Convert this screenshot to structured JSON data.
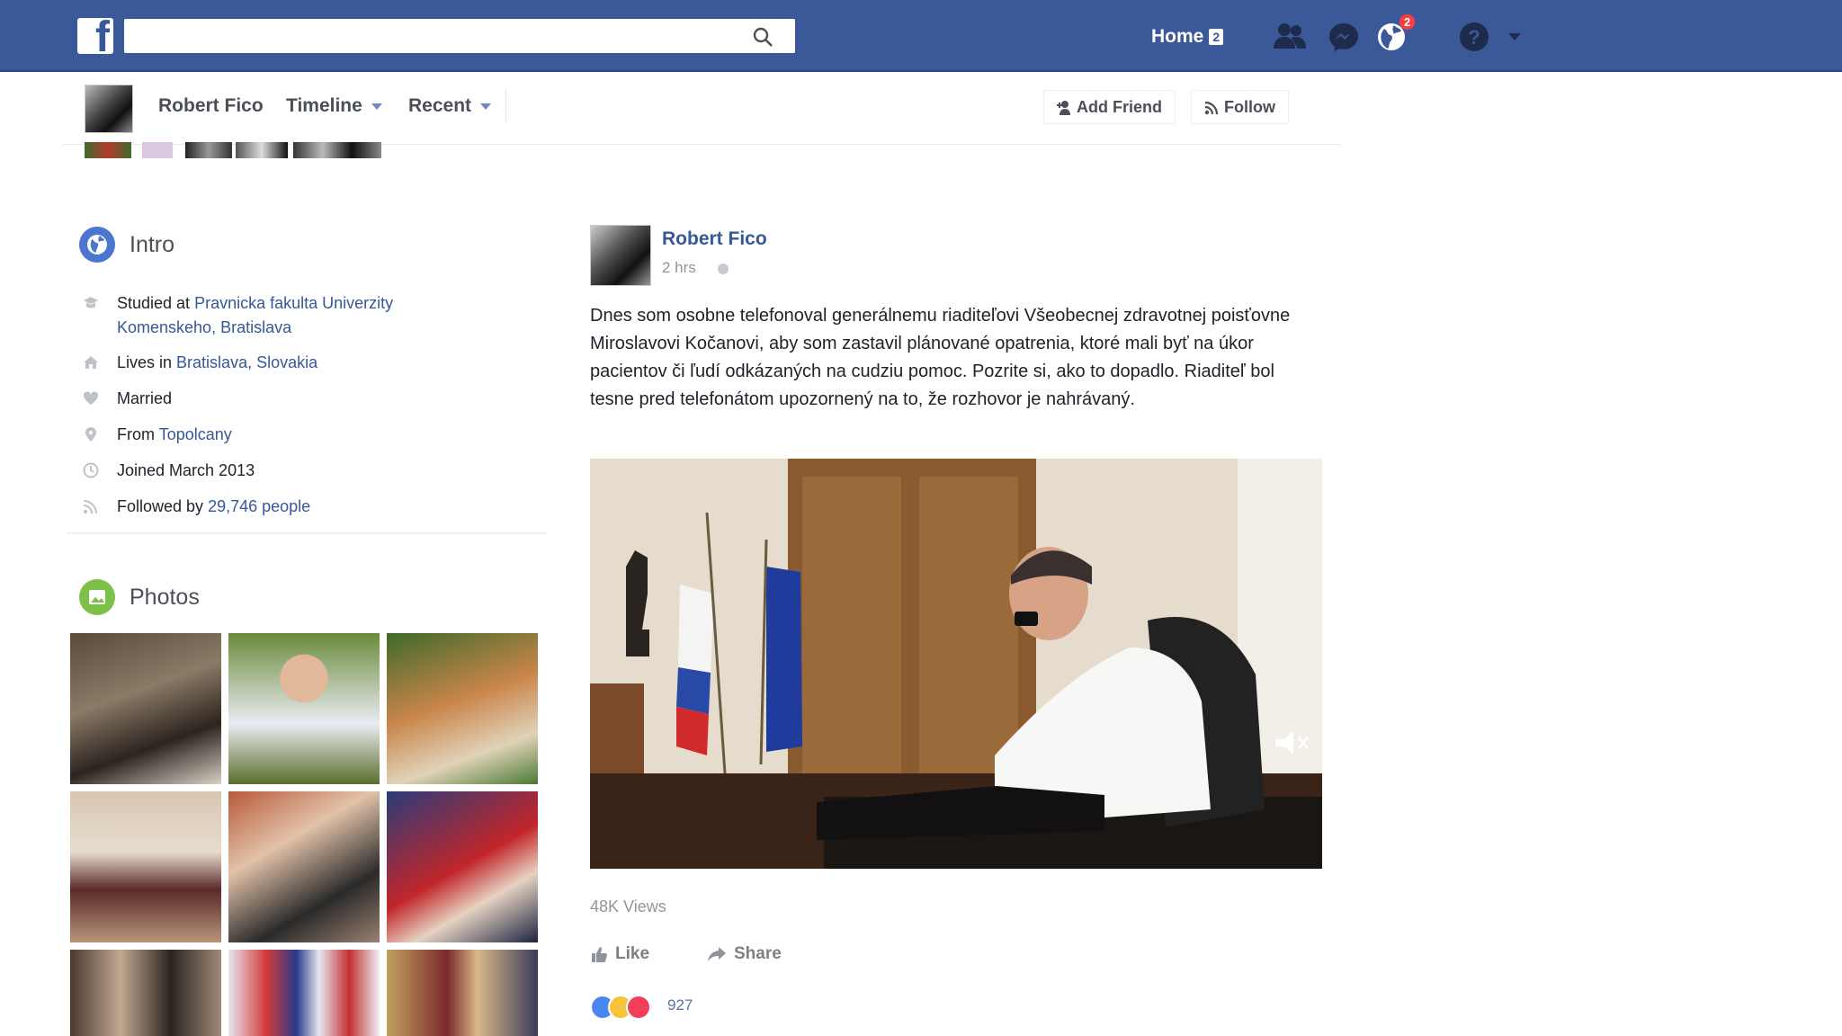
{
  "topbar": {
    "search_placeholder": "",
    "home_label": "Home",
    "home_count": "2",
    "notifications_count": "2",
    "icons": [
      "facebook-logo",
      "search-icon",
      "friends-icon",
      "messenger-icon",
      "notifications-globe-icon",
      "help-icon",
      "caret-down-icon"
    ]
  },
  "profile_nav": {
    "name": "Robert Fico",
    "timeline_label": "Timeline",
    "recent_label": "Recent",
    "add_friend_label": "Add Friend",
    "follow_label": "Follow"
  },
  "intro": {
    "title": "Intro",
    "studied_prefix": "Studied at",
    "studied_link": "Pravnicka fakulta Univerzity Komenskeho, Bratislava",
    "lives_prefix": "Lives in",
    "lives_city": "Bratislava",
    "lives_country": "Slovakia",
    "married": "Married",
    "from_prefix": "From",
    "from_link": "Topolcany",
    "joined": "Joined March 2013",
    "followed_prefix": "Followed by",
    "followed_link": "29,746 people"
  },
  "photos": {
    "title": "Photos"
  },
  "post": {
    "author": "Robert Fico",
    "time": "2 hrs",
    "text": "Dnes som osobne telefonoval generálnemu riaditeľovi Všeobecnej zdravotnej poisťovne Miroslavovi Kočanovi, aby som zastavil plánované opatrenia, ktoré mali byť na úkor pacientov či ľudí odkázaných na cudziu pomoc. Pozrite si, ako to dopadlo. Riaditeľ bol tesne pred telefonátom upozornený na to, že rozhovor je nahrávaný.",
    "views": "48K Views",
    "like_label": "Like",
    "share_label": "Share",
    "reaction_count": "927"
  },
  "colors": {
    "brand_blue": "#3b5998",
    "link_blue": "#365899",
    "badge_red": "#fa3e3e"
  }
}
